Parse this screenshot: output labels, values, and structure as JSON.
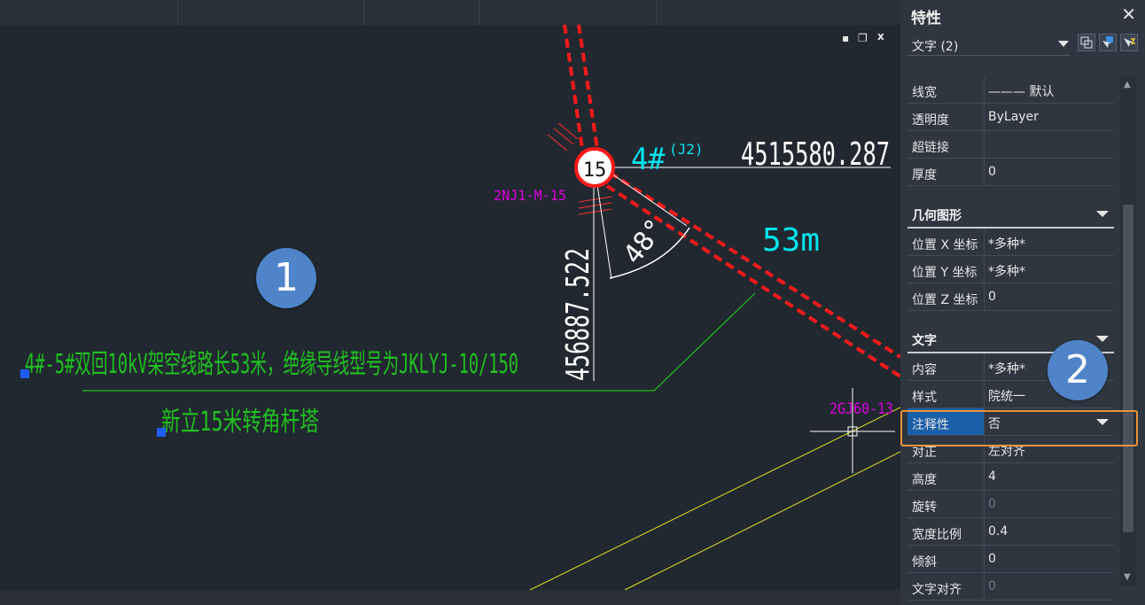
{
  "window_controls": {
    "minimize": "▪",
    "restore": "❐",
    "close": "x"
  },
  "callouts": {
    "one": "1",
    "two": "2"
  },
  "drawing": {
    "coord_right": "4515580.287",
    "coord_vertical": "456887.522",
    "pole_number": "15",
    "pole_label_main": "4#",
    "pole_label_sub": "(J2)",
    "span_length": "53m",
    "angle": "48°",
    "label_2nj": "2NJ1-M-15",
    "label_2gj": "2GJ60-13",
    "note_line1": "4#-5#双回10kV架空线路长53米，绝缘导线型号为JKLYJ-10/150",
    "note_line2": "新立15米转角杆塔"
  },
  "panel": {
    "title": "特性",
    "close": "✕",
    "selector_value": "文字 (2)",
    "general_rows": [
      {
        "key": "线宽",
        "value": "——— 默认"
      },
      {
        "key": "透明度",
        "value": "ByLayer"
      },
      {
        "key": "超链接",
        "value": ""
      },
      {
        "key": "厚度",
        "value": "0"
      }
    ],
    "geometry_title": "几何图形",
    "geometry_rows": [
      {
        "key": "位置 X 坐标",
        "value": "*多种*"
      },
      {
        "key": "位置 Y 坐标",
        "value": "*多种*"
      },
      {
        "key": "位置 Z 坐标",
        "value": "0"
      }
    ],
    "text_title": "文字",
    "text_rows": [
      {
        "key": "内容",
        "value": "*多种*"
      },
      {
        "key": "样式",
        "value": "院统一"
      },
      {
        "key": "注释性",
        "value": "否"
      },
      {
        "key": "对正",
        "value": "左对齐"
      },
      {
        "key": "高度",
        "value": "4"
      },
      {
        "key": "旋转",
        "value": "0"
      },
      {
        "key": "宽度比例",
        "value": "0.4"
      },
      {
        "key": "倾斜",
        "value": "0"
      },
      {
        "key": "文字对齐",
        "value": "0"
      }
    ]
  },
  "colors": {
    "accent_highlight": "#e8953a",
    "callout": "#4f84c9",
    "selected_key": "#1a5fa8",
    "red_line": "#ff1a1a",
    "cyan_text": "#00e5ee",
    "magenta_text": "#e000e0",
    "green_text": "#20c020",
    "yellow_line": "#e0e020"
  }
}
